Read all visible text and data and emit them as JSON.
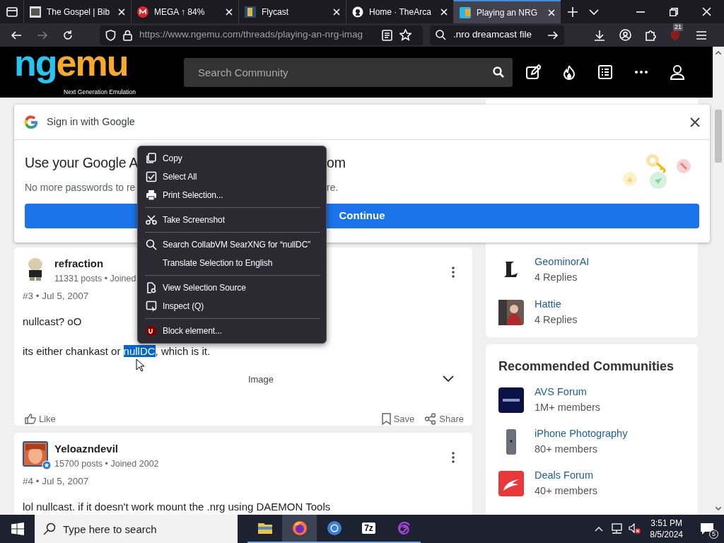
{
  "browser": {
    "tabs": [
      {
        "title": "The Gospel | Bib",
        "selected": false
      },
      {
        "title": "MEGA ↑ 84%",
        "selected": false
      },
      {
        "title": "Flycast",
        "selected": false
      },
      {
        "title": "Home · TheArca",
        "selected": false
      },
      {
        "title": "Playing an NRG",
        "selected": true
      }
    ],
    "url": "https://www.ngemu.com/threads/playing-an-nrg-imag",
    "search_value": ".nro dreamcast file",
    "extension_badge": "21"
  },
  "site": {
    "logo_left": "ng",
    "logo_right": "emu",
    "tagline": "Next Generation Emulation",
    "search_placeholder": "Search Community"
  },
  "posts": [
    {
      "author": "refraction",
      "meta": "11331 posts • Joined",
      "number_date": "#3 • Jul 5, 2007",
      "badge": false,
      "lines": [
        [
          {
            "text": "nullcast? oO",
            "selected": false
          }
        ],
        [
          {
            "text": "its either chankast or ",
            "selected": false
          },
          {
            "text": "nullDC",
            "selected": true
          },
          {
            "text": ", which is it.",
            "selected": false
          }
        ]
      ],
      "image_label": "Image",
      "actions": {
        "like": "Like",
        "save": "Save",
        "share": "Share"
      }
    },
    {
      "author": "Yeloazndevil",
      "meta": "15700 posts • Joined 2002",
      "number_date": "#4 • Jul 5, 2007",
      "badge": true,
      "lines": [
        [
          {
            "text": "lol nullcast. if it doesn't work mount the .nrg using DAEMON Tools",
            "selected": false
          }
        ]
      ]
    }
  ],
  "sidebar": {
    "replies": [
      {
        "name": "GeominorAI",
        "count": "4 Replies"
      },
      {
        "name": "Hattie",
        "count": "4 Replies"
      }
    ],
    "communities_title": "Recommended Communities",
    "communities": [
      {
        "name": "AVS Forum",
        "members": "1M+ members",
        "color": "#0b1045"
      },
      {
        "name": "iPhone Photography",
        "members": "80+ members",
        "color": "#6b7078"
      },
      {
        "name": "Deals Forum",
        "members": "40+ members",
        "color": "#e8383a"
      }
    ]
  },
  "google_popup": {
    "title": "Sign in with Google",
    "heading_left": "Use your Google A",
    "heading_right": "om",
    "text_left": "No more passwords to re",
    "text_right": "re.",
    "button": "Continue"
  },
  "context_menu": [
    {
      "kind": "item",
      "label": "Copy"
    },
    {
      "kind": "item",
      "label": "Select All"
    },
    {
      "kind": "item",
      "label": "Print Selection..."
    },
    {
      "kind": "separator"
    },
    {
      "kind": "item",
      "label": "Take Screenshot"
    },
    {
      "kind": "separator"
    },
    {
      "kind": "item",
      "label": "Search CollabVM SearXNG for “nullDC”"
    },
    {
      "kind": "item",
      "label": "Translate Selection to English"
    },
    {
      "kind": "separator"
    },
    {
      "kind": "item",
      "label": "View Selection Source"
    },
    {
      "kind": "item",
      "label": "Inspect (Q)"
    },
    {
      "kind": "separator"
    },
    {
      "kind": "item",
      "label": "Block element..."
    }
  ],
  "taskbar": {
    "search_placeholder": "Type here to search",
    "apps": [
      {
        "kind": "explorer",
        "selected": false
      },
      {
        "kind": "firefox",
        "selected": true
      },
      {
        "kind": "chromium",
        "selected": false
      },
      {
        "kind": "sevenzip",
        "label": "7z",
        "selected": false
      },
      {
        "kind": "spiral",
        "selected": false
      }
    ],
    "time": "3:51 PM",
    "date": "8/5/2024",
    "notifications": "5"
  }
}
